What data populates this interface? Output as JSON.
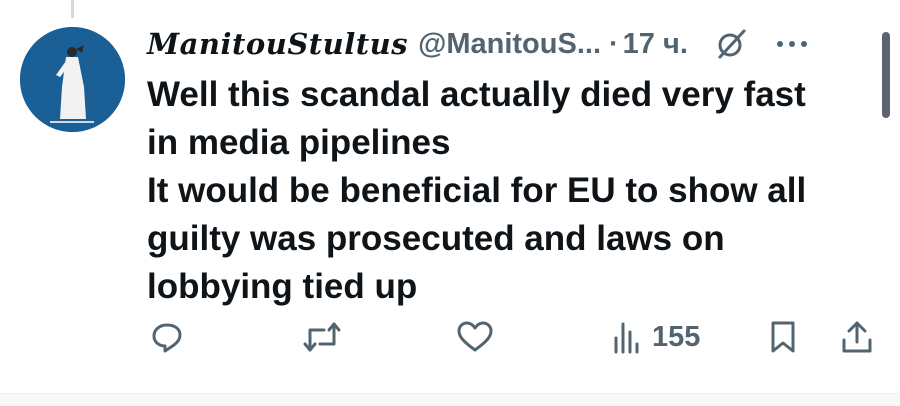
{
  "tweet": {
    "display_name": "ManitouStultus",
    "handle": "@ManitouS...",
    "separator": "·",
    "time": "17 ч.",
    "text_lines": [
      "Well this scandal actually died very fast",
      "in media pipelines",
      "It would be beneficial for EU to show all",
      "guilty was prosecuted and laws on",
      "lobbying tied up"
    ]
  },
  "actions": {
    "views_count": "155"
  },
  "icons": {
    "reply": "reply-icon",
    "retweet": "retweet-icon",
    "like": "heart-icon",
    "views": "views-icon",
    "bookmark": "bookmark-icon",
    "share": "share-icon",
    "grok": "grok-icon",
    "more": "more-icon"
  },
  "colors": {
    "text": "#0f1419",
    "secondary": "#536471",
    "avatar_bg": "#1b5f97",
    "background": "#ffffff"
  }
}
